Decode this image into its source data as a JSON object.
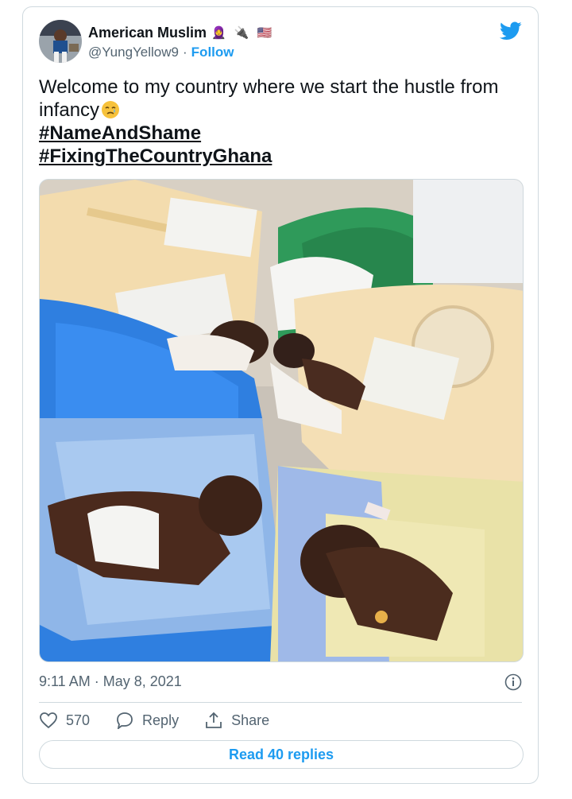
{
  "tweet": {
    "author_name": "American Muslim",
    "author_emoji": "🧕 🔌 🇺🇸",
    "handle": "@YungYellow9",
    "separator": "·",
    "follow_label": "Follow",
    "text_line1": "Welcome to my country where we start the hustle from infancy",
    "hashtag1": "#NameAndShame",
    "hashtag2": "#FixingTheCountryGhana",
    "timestamp": "9:11 AM · May 8, 2021",
    "like_count": "570",
    "reply_label": "Reply",
    "share_label": "Share",
    "read_replies_label": "Read 40 replies"
  },
  "colors": {
    "accent": "#1d9bf0",
    "secondary_text": "#536471",
    "border": "#cfd9de"
  },
  "icons": {
    "logo": "twitter-bird-icon",
    "emoji": "crying-face-icon",
    "like": "heart-icon",
    "reply": "speech-bubble-icon",
    "share": "upload-icon",
    "info": "info-icon"
  }
}
